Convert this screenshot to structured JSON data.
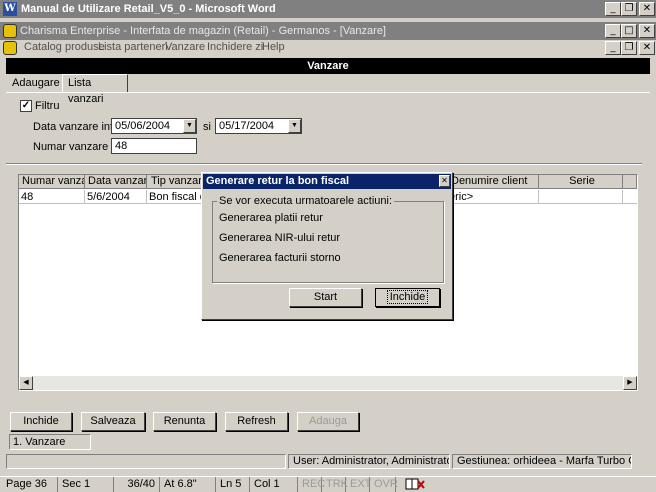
{
  "word_window": {
    "title": "Manual de Utilizare Retail_V5_0 - Microsoft Word"
  },
  "app_window": {
    "title": "Charisma Enterprise - Interfata de magazin (Retail) - Germanos - [Vanzare]",
    "menu": [
      "Catalog produse",
      "Lista parteneri",
      "Vanzare",
      "Inchidere zi",
      "Help"
    ]
  },
  "form": {
    "header_title": "Vanzare",
    "tabs": {
      "add": "Adaugare",
      "list": "Lista vanzari"
    },
    "filter": {
      "label": "Filtru",
      "checked": true,
      "date_label": "Data vanzare intre",
      "date_from": "05/06/2004",
      "date_sep": "si",
      "date_to": "05/17/2004",
      "number_label": "Numar vanzare",
      "number_value": "48"
    },
    "grid": {
      "columns": [
        "Numar vanzare",
        "Data vanzarii",
        "Tip vanzare",
        "Denumire client",
        "Serie"
      ],
      "rows": [
        {
          "numar": "48",
          "data": "5/6/2004",
          "tip": "Bon fiscal de",
          "client": "eric>",
          "serie": ""
        }
      ]
    },
    "buttons": {
      "close": "Inchide",
      "save": "Salveaza",
      "cancel": "Renunta",
      "refresh": "Refresh",
      "add": "Adauga"
    },
    "window_list_item": "1. Vanzare",
    "status": {
      "user": "User: Administrator, Administrator",
      "management": "Gestiunea: orhideea - Marfa Turbo Carre"
    }
  },
  "dialog": {
    "title": "Generare retur la bon fiscal",
    "group_label": "Se vor executa urmatoarele actiuni:",
    "actions": [
      "Generarea platii retur",
      "Generarea NIR-ului retur",
      "Generarea facturii storno"
    ],
    "start_button": "Start",
    "close_button": "Inchide"
  },
  "word_status": {
    "page": "Page 36",
    "sec": "Sec 1",
    "pages": "36/40",
    "at": "At 6.8\"",
    "ln": "Ln 5",
    "col": "Col 1",
    "rec": "REC",
    "trk": "TRK",
    "ext": "EXT",
    "ovr": "OVR"
  },
  "colors": {
    "title_bar_inactive": "#808080",
    "dialog_title": "#0a246a",
    "section_header": "#000000",
    "face": "#d4d0c8"
  }
}
